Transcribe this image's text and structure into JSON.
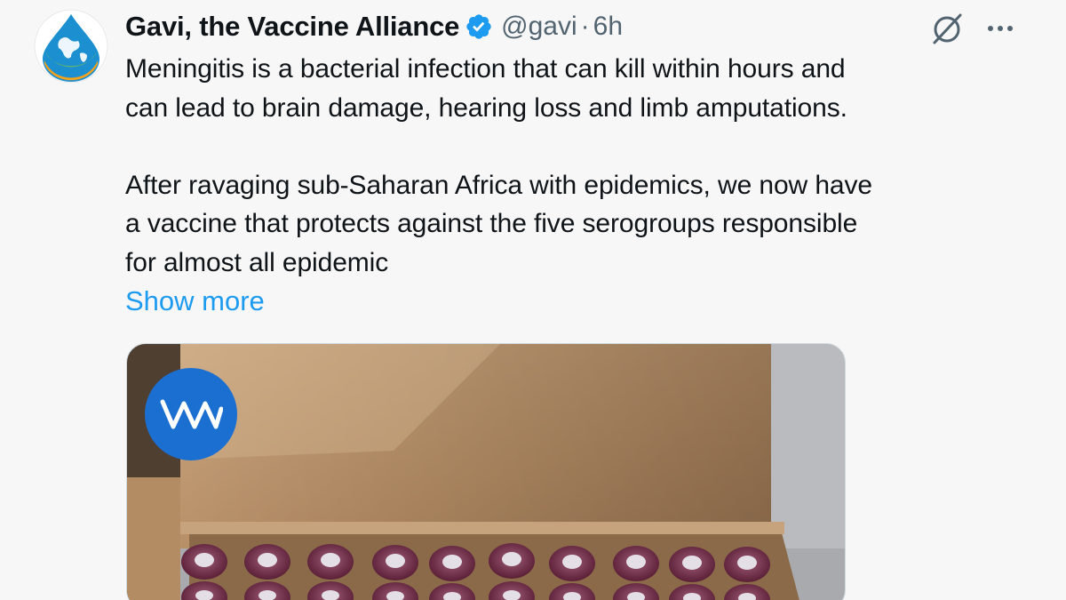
{
  "tweet": {
    "author": {
      "display_name": "Gavi, the Vaccine Alliance",
      "handle": "@gavi",
      "separator": "·",
      "time": "6h",
      "verified": true,
      "avatar_icon": "gavi-globe-drop-logo"
    },
    "text_lines_para1": [
      "Meningitis is a bacterial infection that can kill within hours and",
      "can lead to brain damage, hearing loss and limb amputations."
    ],
    "text_lines_para2": [
      "After ravaging sub-Saharan Africa with epidemics, we now have",
      "a vaccine that protects against the five serogroups responsible",
      "for almost all epidemic"
    ],
    "show_more_label": "Show more",
    "media": {
      "badge_text": "W\\"
    },
    "icons": {
      "grok": "grok-icon",
      "more": "more-options-icon",
      "verified": "verified-badge-icon"
    },
    "colors": {
      "link": "#1d9bf0",
      "secondary_text": "#536471",
      "verified": "#1d9bf0",
      "badge_bg": "#1b6fd1"
    }
  }
}
